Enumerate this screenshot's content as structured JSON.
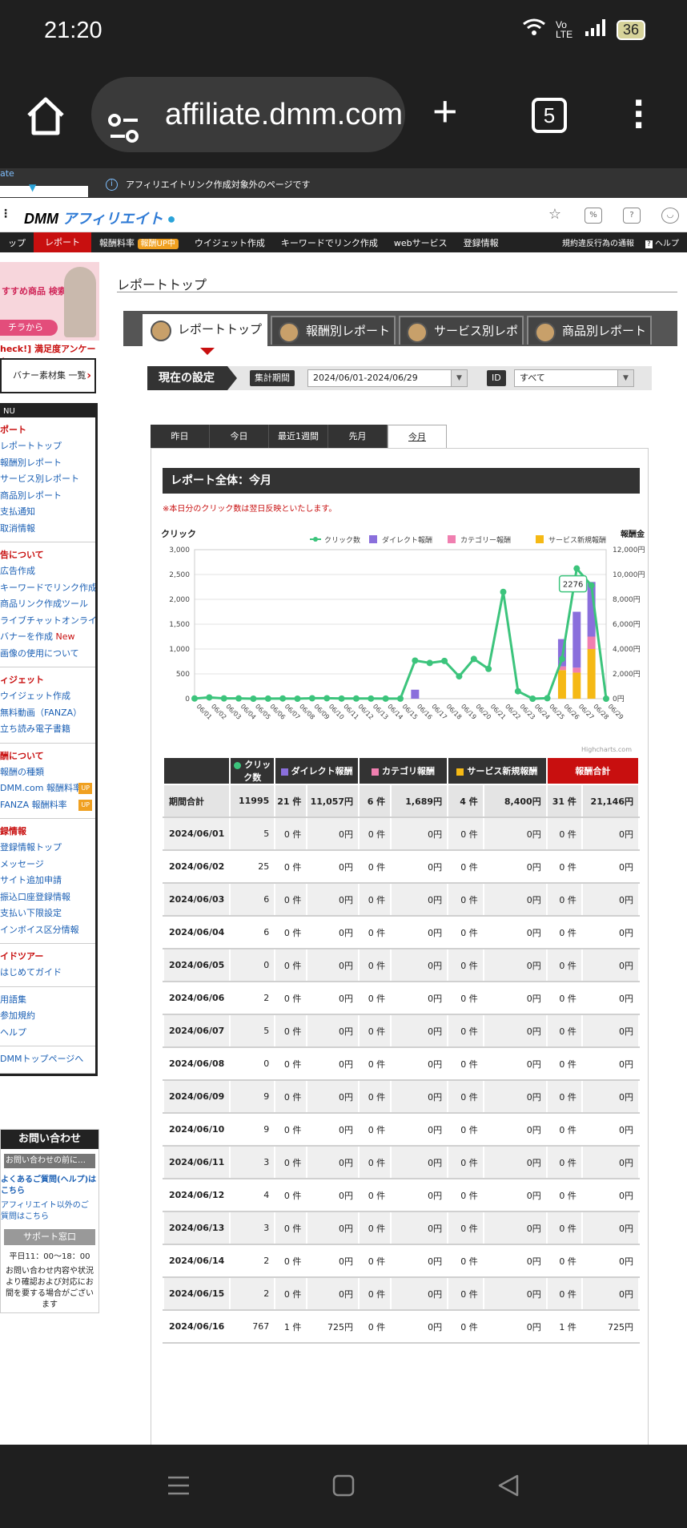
{
  "status": {
    "time": "21:20",
    "battery": "36",
    "network": "Vo LTE"
  },
  "browser": {
    "url": "affiliate.dmm.com",
    "tab_count": "5"
  },
  "infobar": {
    "ext_label": "ate",
    "message": "アフィリエイトリンク作成対象外のページです"
  },
  "site": {
    "logo_dmm": "DMM",
    "logo_affiliate": "アフィリエイト",
    "nav": {
      "report": "レポート",
      "reward_rate": "報酬料率",
      "reward_up": "報酬UP中",
      "widget": "ウイジェット作成",
      "keyword": "キーワードでリンク作成",
      "web": "webサービス",
      "registration": "登録情報",
      "violation": "規約違反行為の通報",
      "help": "ヘルプ"
    }
  },
  "sidebar": {
    "banner_text": "すすめ商品 検索ワード",
    "banner_btn": "チラから",
    "survey": "heck!] 満足度アンケート",
    "banner_list": "バナー素材集 一覧",
    "menu_label": "NU",
    "sections": [
      {
        "title": "ポート",
        "items": [
          "レポートトップ",
          "報酬別レポート",
          "サービス別レポート",
          "商品別レポート",
          "支払通知",
          "取消情報"
        ]
      },
      {
        "title": "告について",
        "items": [
          "広告作成",
          "キーワードでリンク作成",
          "商品リンク作成ツール",
          "ライブチャットオンライ",
          "バナーを作成 ",
          "画像の使用について"
        ]
      },
      {
        "title": "ィジェット",
        "items": [
          "ウイジェット作成",
          "無料動画（FANZA）",
          "立ち読み電子書籍"
        ]
      },
      {
        "title": "酬について",
        "items": [
          "報酬の種類",
          "DMM.com 報酬料率",
          "FANZA 報酬料率"
        ]
      },
      {
        "title": "録情報",
        "items": [
          "登録情報トップ",
          "メッセージ",
          "サイト追加申請",
          "振込口座登録情報",
          "支払い下限設定",
          "インボイス区分情報"
        ]
      },
      {
        "title": "イドツアー",
        "items": [
          "はじめてガイド"
        ]
      },
      {
        "title": "",
        "items": [
          "用語集",
          "参加規約",
          "ヘルプ"
        ]
      },
      {
        "title": "",
        "items": [
          "DMMトップページへ"
        ]
      }
    ],
    "new_badge": "New",
    "up_badge": "UP",
    "contact": {
      "title": "お問い合わせ",
      "before": "お問い合わせの前に…",
      "faq": "よくあるご質問(ヘルプ)は こちら",
      "other": "アフィリエイト以外のご 質問はこちら",
      "support": "サポート窓口",
      "hours": "平日11：00〜18：00",
      "note": "お問い合わせ内容や状況 より確認および対応にお 間を要する場合がござい ます"
    }
  },
  "main": {
    "page_title": "レポートトップ",
    "tabs": [
      "レポートトップ",
      "報酬別レポート",
      "サービス別レポート",
      "商品別レポート"
    ],
    "current_settings": "現在の設定",
    "period_label": "集計期間",
    "period_value": "2024/06/01-2024/06/29",
    "id_label": "ID",
    "id_value": "すべて",
    "period_tabs": [
      "昨日",
      "今日",
      "最近1週間",
      "先月",
      "今月"
    ],
    "panel_title": "レポート全体：今月",
    "note": "※本日分のクリック数は翌日反映といたします。",
    "credits": "Highcharts.com"
  },
  "chart_data": {
    "type": "line",
    "title": "",
    "ylabel_left": "クリック",
    "ylabel_right": "報酬金",
    "ylim_left": [
      0,
      3000
    ],
    "ylim_right": [
      0,
      12000
    ],
    "yticks_left": [
      "0",
      "500",
      "1,000",
      "1,500",
      "2,000",
      "2,500",
      "3,000"
    ],
    "yticks_right": [
      "0円",
      "2,000円",
      "4,000円",
      "6,000円",
      "8,000円",
      "10,000円",
      "12,000円"
    ],
    "legend": "top-right",
    "categories": [
      "06/01",
      "06/02",
      "06/03",
      "06/04",
      "06/05",
      "06/06",
      "06/07",
      "06/08",
      "06/09",
      "06/10",
      "06/11",
      "06/12",
      "06/13",
      "06/14",
      "06/15",
      "06/16",
      "06/17",
      "06/18",
      "06/19",
      "06/20",
      "06/21",
      "06/22",
      "06/23",
      "06/24",
      "06/25",
      "06/26",
      "06/27",
      "06/28",
      "06/29"
    ],
    "series": [
      {
        "name": "クリック数",
        "type": "line",
        "color": "#3cc47c",
        "values": [
          5,
          25,
          6,
          6,
          0,
          2,
          5,
          0,
          9,
          9,
          3,
          4,
          3,
          2,
          2,
          767,
          720,
          760,
          450,
          800,
          600,
          2150,
          150,
          0,
          10,
          800,
          2620,
          2280,
          0
        ]
      },
      {
        "name": "ダイレクト報酬",
        "type": "column",
        "color": "#8a6fdc",
        "values": [
          0,
          0,
          0,
          0,
          0,
          0,
          0,
          0,
          0,
          0,
          0,
          0,
          0,
          0,
          0,
          725,
          0,
          0,
          0,
          0,
          0,
          0,
          0,
          0,
          0,
          2200,
          4500,
          4400,
          0
        ]
      },
      {
        "name": "カテゴリー報酬",
        "type": "column",
        "color": "#f07fb0",
        "values": [
          0,
          0,
          0,
          0,
          0,
          0,
          0,
          0,
          0,
          0,
          0,
          0,
          0,
          0,
          0,
          0,
          0,
          0,
          0,
          0,
          0,
          0,
          0,
          0,
          0,
          300,
          400,
          1000,
          0
        ]
      },
      {
        "name": "サービス新規報酬",
        "type": "column",
        "color": "#f5b915",
        "values": [
          0,
          0,
          0,
          0,
          0,
          0,
          0,
          0,
          0,
          0,
          0,
          0,
          0,
          0,
          0,
          0,
          0,
          0,
          0,
          0,
          0,
          0,
          0,
          0,
          0,
          2300,
          2100,
          4000,
          0
        ]
      }
    ],
    "tooltip": "2276"
  },
  "table": {
    "headers": [
      "",
      "クリック数",
      "ダイレクト報酬",
      "カテゴリ報酬",
      "サービス新規報酬",
      "報酬合計"
    ],
    "total": [
      "期間合計",
      "11995",
      "21 件",
      "11,057円",
      "6 件",
      "1,689円",
      "4 件",
      "8,400円",
      "31 件",
      "21,146円"
    ],
    "rows": [
      [
        "2024/06/01",
        "5",
        "0 件",
        "0円",
        "0 件",
        "0円",
        "0 件",
        "0円",
        "0 件",
        "0円"
      ],
      [
        "2024/06/02",
        "25",
        "0 件",
        "0円",
        "0 件",
        "0円",
        "0 件",
        "0円",
        "0 件",
        "0円"
      ],
      [
        "2024/06/03",
        "6",
        "0 件",
        "0円",
        "0 件",
        "0円",
        "0 件",
        "0円",
        "0 件",
        "0円"
      ],
      [
        "2024/06/04",
        "6",
        "0 件",
        "0円",
        "0 件",
        "0円",
        "0 件",
        "0円",
        "0 件",
        "0円"
      ],
      [
        "2024/06/05",
        "0",
        "0 件",
        "0円",
        "0 件",
        "0円",
        "0 件",
        "0円",
        "0 件",
        "0円"
      ],
      [
        "2024/06/06",
        "2",
        "0 件",
        "0円",
        "0 件",
        "0円",
        "0 件",
        "0円",
        "0 件",
        "0円"
      ],
      [
        "2024/06/07",
        "5",
        "0 件",
        "0円",
        "0 件",
        "0円",
        "0 件",
        "0円",
        "0 件",
        "0円"
      ],
      [
        "2024/06/08",
        "0",
        "0 件",
        "0円",
        "0 件",
        "0円",
        "0 件",
        "0円",
        "0 件",
        "0円"
      ],
      [
        "2024/06/09",
        "9",
        "0 件",
        "0円",
        "0 件",
        "0円",
        "0 件",
        "0円",
        "0 件",
        "0円"
      ],
      [
        "2024/06/10",
        "9",
        "0 件",
        "0円",
        "0 件",
        "0円",
        "0 件",
        "0円",
        "0 件",
        "0円"
      ],
      [
        "2024/06/11",
        "3",
        "0 件",
        "0円",
        "0 件",
        "0円",
        "0 件",
        "0円",
        "0 件",
        "0円"
      ],
      [
        "2024/06/12",
        "4",
        "0 件",
        "0円",
        "0 件",
        "0円",
        "0 件",
        "0円",
        "0 件",
        "0円"
      ],
      [
        "2024/06/13",
        "3",
        "0 件",
        "0円",
        "0 件",
        "0円",
        "0 件",
        "0円",
        "0 件",
        "0円"
      ],
      [
        "2024/06/14",
        "2",
        "0 件",
        "0円",
        "0 件",
        "0円",
        "0 件",
        "0円",
        "0 件",
        "0円"
      ],
      [
        "2024/06/15",
        "2",
        "0 件",
        "0円",
        "0 件",
        "0円",
        "0 件",
        "0円",
        "0 件",
        "0円"
      ],
      [
        "2024/06/16",
        "767",
        "1 件",
        "725円",
        "0 件",
        "0円",
        "0 件",
        "0円",
        "1 件",
        "725円"
      ]
    ]
  },
  "colors": {
    "brand_red": "#c80f0f",
    "dark": "#222222",
    "link": "#1a5fb4"
  }
}
